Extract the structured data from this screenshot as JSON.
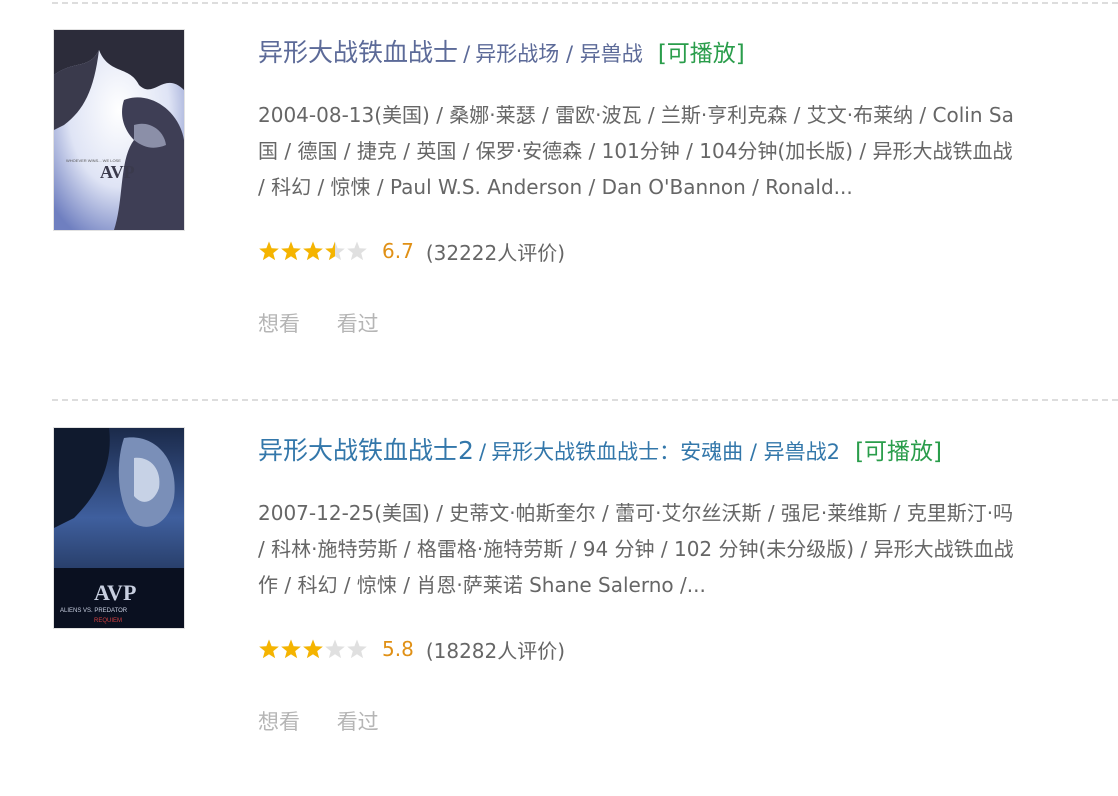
{
  "movies": [
    {
      "title": "异形大战铁血战士",
      "separator": "/",
      "alt_titles": "异形战场 / 异兽战",
      "playable": "[可播放]",
      "meta_lines": [
        "2004-08-13(美国) / 桑娜·莱瑟 / 雷欧·波瓦 / 兰斯·亨利克森 / 艾文·布莱纳 / Colin Sa",
        "国 / 德国 / 捷克 / 英国 / 保罗·安德森 / 101分钟 / 104分钟(加长版) / 异形大战铁血战",
        "/ 科幻 / 惊悚 / Paul W.S. Anderson / Dan O'Bannon / Ronald..."
      ],
      "rating_value": 3.5,
      "rating_max": 5,
      "score": "6.7",
      "count": "(32222人评价)",
      "action_want": "想看",
      "action_seen": "看过",
      "poster_text": "AVP",
      "poster_tagline": "WHOEVER WINS... WE LOSE"
    },
    {
      "title": "异形大战铁血战士2",
      "separator": "/",
      "alt_titles": "异形大战铁血战士：安魂曲 / 异兽战2",
      "playable": "[可播放]",
      "meta_lines": [
        "2007-12-25(美国) / 史蒂文·帕斯奎尔 / 蕾可·艾尔丝沃斯 / 强尼·莱维斯 / 克里斯汀·吗",
        "/ 科林·施特劳斯 / 格雷格·施特劳斯 / 94 分钟 / 102 分钟(未分级版) / 异形大战铁血战",
        "作 / 科幻 / 惊悚 / 肖恩·萨莱诺 Shane Salerno /..."
      ],
      "rating_value": 3,
      "rating_max": 5,
      "score": "5.8",
      "count": "(18282人评价)",
      "action_want": "想看",
      "action_seen": "看过",
      "poster_text": "AVP",
      "poster_tagline": "ALIENS VS. PREDATOR",
      "poster_subtitle": "REQUIEM"
    }
  ],
  "colors": {
    "title_link": "#3377aa",
    "playable": "#2a9d4b",
    "score": "#e09015",
    "star_fill": "#f5b400",
    "star_empty": "#e0e0e0",
    "meta_text": "#666666",
    "action_text": "#b5b5b5"
  }
}
